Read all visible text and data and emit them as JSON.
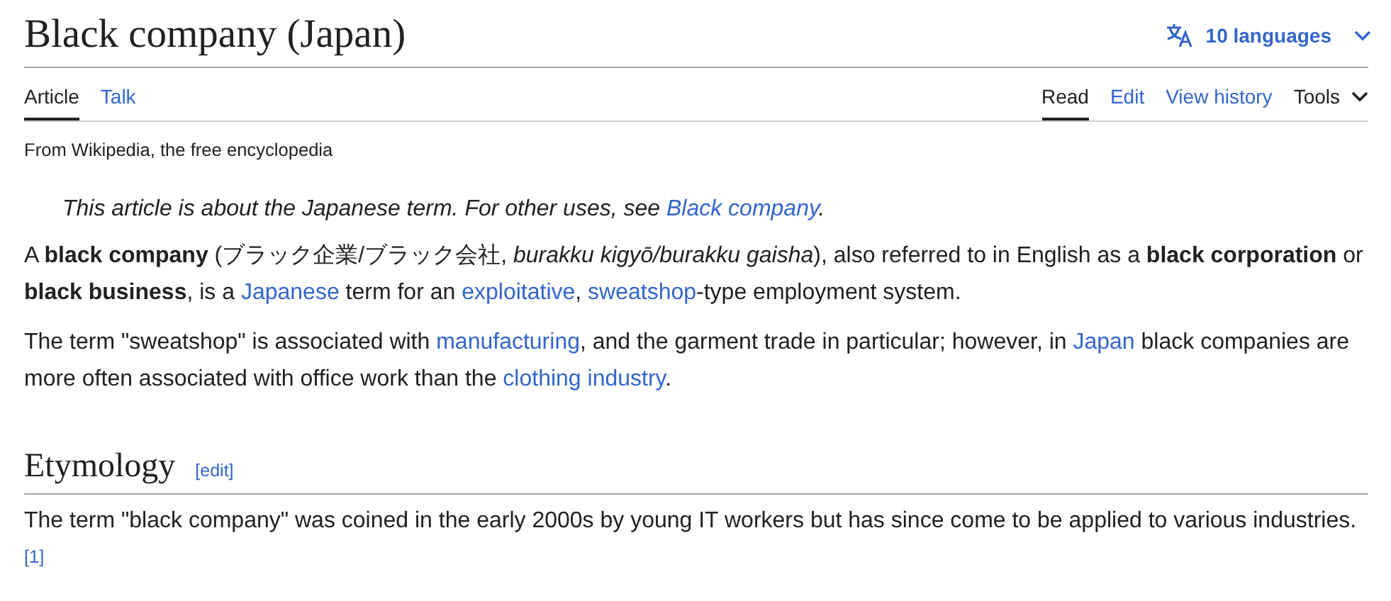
{
  "title": "Black company (Japan)",
  "languages": {
    "label": "10 languages"
  },
  "tabs_left": [
    {
      "label": "Article",
      "selected": true
    },
    {
      "label": "Talk",
      "selected": false
    }
  ],
  "tabs_right": [
    {
      "label": "Read",
      "selected": true,
      "kind": "tab"
    },
    {
      "label": "Edit",
      "selected": false,
      "kind": "tab"
    },
    {
      "label": "View history",
      "selected": false,
      "kind": "tab"
    },
    {
      "label": "Tools",
      "selected": false,
      "kind": "menu"
    }
  ],
  "tagline": "From Wikipedia, the free encyclopedia",
  "hatnote": [
    {
      "kind": "text",
      "text": "This article is about the Japanese term. For other uses, see "
    },
    {
      "kind": "link",
      "text": "Black company"
    },
    {
      "kind": "text",
      "text": "."
    }
  ],
  "paragraphs": [
    [
      {
        "kind": "text",
        "text": "A "
      },
      {
        "kind": "bold",
        "text": "black company"
      },
      {
        "kind": "text",
        "text": " (ブラック企業/ブラック会社, "
      },
      {
        "kind": "italic",
        "text": "burakku kigyō/burakku gaisha"
      },
      {
        "kind": "text",
        "text": "), also referred to in English as a "
      },
      {
        "kind": "bold",
        "text": "black corporation"
      },
      {
        "kind": "text",
        "text": " or "
      },
      {
        "kind": "bold",
        "text": "black business"
      },
      {
        "kind": "text",
        "text": ", is a "
      },
      {
        "kind": "link",
        "text": "Japanese"
      },
      {
        "kind": "text",
        "text": " term for an "
      },
      {
        "kind": "link",
        "text": "exploitative"
      },
      {
        "kind": "text",
        "text": ", "
      },
      {
        "kind": "link",
        "text": "sweatshop"
      },
      {
        "kind": "text",
        "text": "-type employment system."
      }
    ],
    [
      {
        "kind": "text",
        "text": "The term \"sweatshop\" is associated with "
      },
      {
        "kind": "link",
        "text": "manufacturing"
      },
      {
        "kind": "text",
        "text": ", and the garment trade in particular; however, in "
      },
      {
        "kind": "link",
        "text": "Japan"
      },
      {
        "kind": "text",
        "text": " black companies are more often associated with office work than the "
      },
      {
        "kind": "link",
        "text": "clothing industry"
      },
      {
        "kind": "text",
        "text": "."
      }
    ]
  ],
  "section": {
    "heading": "Etymology",
    "edit": "[edit]",
    "paragraphs": [
      [
        {
          "kind": "text",
          "text": "The term \"black company\" was coined in the early 2000s by young IT workers but has since come to be applied to various industries."
        },
        {
          "kind": "ref",
          "text": "[1]"
        }
      ]
    ]
  }
}
